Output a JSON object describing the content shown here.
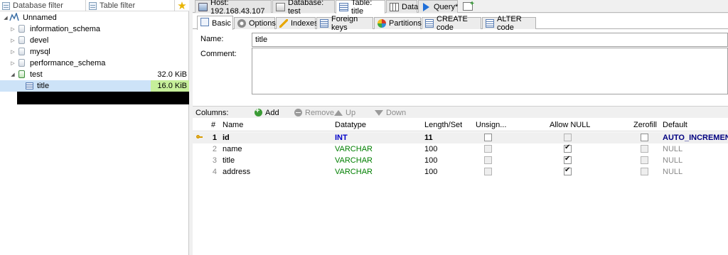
{
  "filters": {
    "database_filter": "Database filter",
    "table_filter": "Table filter"
  },
  "tree": {
    "root": "Unnamed",
    "databases": [
      {
        "label": "information_schema"
      },
      {
        "label": "devel"
      },
      {
        "label": "mysql"
      },
      {
        "label": "performance_schema"
      }
    ],
    "test": {
      "label": "test",
      "size": "32.0 KiB"
    },
    "table": {
      "label": "title",
      "size": "16.0 KiB"
    }
  },
  "top_tabs": {
    "host": "Host: 192.168.43.107",
    "database": "Database: test",
    "table": "Table: title",
    "data": "Data",
    "query": "Query*"
  },
  "sub_tabs": {
    "basic": "Basic",
    "options": "Options",
    "indexes": "Indexes",
    "foreign_keys": "Foreign keys",
    "partitions": "Partitions",
    "create_code": "CREATE code",
    "alter_code": "ALTER code"
  },
  "form": {
    "name_label": "Name:",
    "name_value": "title",
    "comment_label": "Comment:"
  },
  "columns_toolbar": {
    "label": "Columns:",
    "add": "Add",
    "remove": "Remove",
    "up": "Up",
    "down": "Down"
  },
  "grid": {
    "headers": {
      "num": "#",
      "name": "Name",
      "datatype": "Datatype",
      "length": "Length/Set",
      "unsigned": "Unsign...",
      "allow_null": "Allow NULL",
      "zerofill": "Zerofill",
      "default": "Default"
    },
    "rows": [
      {
        "num": "1",
        "name": "id",
        "datatype": "INT",
        "length": "11",
        "unsigned": false,
        "allow_null": false,
        "zerofill": false,
        "default": "AUTO_INCREMENT"
      },
      {
        "num": "2",
        "name": "name",
        "datatype": "VARCHAR",
        "length": "100",
        "unsigned": false,
        "allow_null": true,
        "zerofill": false,
        "default": "NULL"
      },
      {
        "num": "3",
        "name": "title",
        "datatype": "VARCHAR",
        "length": "100",
        "unsigned": false,
        "allow_null": true,
        "zerofill": false,
        "default": "NULL"
      },
      {
        "num": "4",
        "name": "address",
        "datatype": "VARCHAR",
        "length": "100",
        "unsigned": false,
        "allow_null": true,
        "zerofill": false,
        "default": "NULL"
      }
    ]
  },
  "colors": {
    "selection": "#cde3f8",
    "size_bar": "#c6ef9a",
    "int_type": "#0000c8",
    "varchar_type": "#007f00"
  }
}
